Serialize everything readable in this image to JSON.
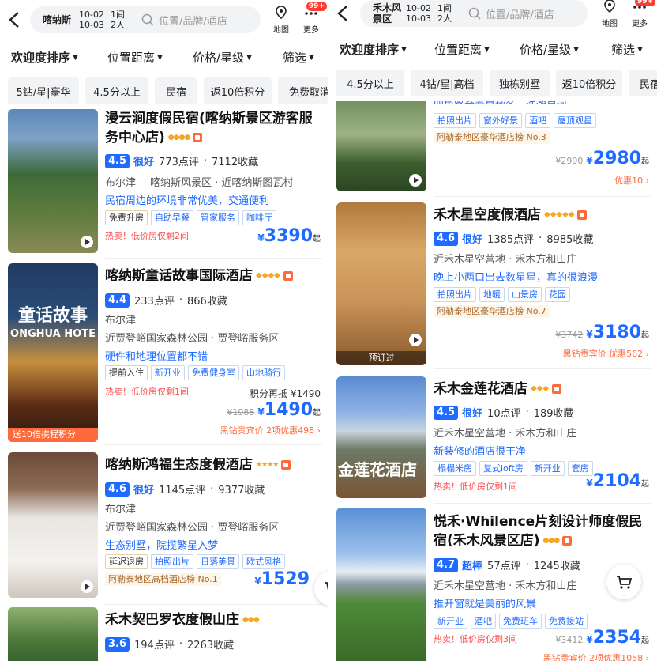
{
  "left": {
    "header": {
      "dest": "喀纳斯",
      "date_in": "10-02",
      "date_out": "10-03",
      "rooms": "1间",
      "people": "2人",
      "placeholder": "位置/品牌/酒店",
      "map": "地图",
      "more": "更多",
      "badge": "99+"
    },
    "sort": [
      "欢迎度排序",
      "位置距离",
      "价格/星级",
      "筛选"
    ],
    "chips": [
      "5钻/星|豪华",
      "4.5分以上",
      "民宿",
      "返10倍积分",
      "免费取消"
    ],
    "hotels": [
      {
        "name": "漫云涧度假民宿(喀纳斯景区游客服务中心店)",
        "score": "4.5",
        "label": "很好",
        "reviews": "773点评",
        "favs": "7112收藏",
        "area": "布尔津",
        "loc": "喀纳斯风景区 · 近喀纳斯图瓦村",
        "quote": "民宿周边的环境非常优美，交通便利",
        "tags": [
          "免费升房",
          "自助早餐",
          "管家服务",
          "咖啡厅"
        ],
        "hot": "热卖！低价房仅剩2间",
        "price": "3390",
        "price_prefix": "¥",
        "price_suffix": "起"
      },
      {
        "name": "喀纳斯童话故事国际酒店",
        "score": "4.4",
        "reviews": "233点评",
        "favs": "866收藏",
        "area": "布尔津",
        "loc": "近贾登峪国家森林公园 · 贾登峪服务区",
        "quote": "硬件和地理位置都不错",
        "tags": [
          "提前入住",
          "新开业",
          "免费健身室",
          "山地骑行"
        ],
        "hot": "热卖！低价房仅剩1间",
        "points": "积分再抵 ¥1490",
        "old": "¥1988",
        "price": "1490",
        "price_prefix": "¥",
        "price_suffix": "起",
        "promo": "黑钻贵宾价  2项优惠498 ›",
        "banner": "送10倍携程积分"
      },
      {
        "name": "喀纳斯鸿福生态度假酒店",
        "score": "4.6",
        "label": "很好",
        "reviews": "1145点评",
        "favs": "9377收藏",
        "area": "布尔津",
        "loc": "近贾登峪国家森林公园 · 贾登峪服务区",
        "quote": "生态别墅，院揽繁星入梦",
        "tags": [
          "延迟退房",
          "拍照出片",
          "日落美景",
          "欧式风格"
        ],
        "rank": "阿勒泰地区高档酒店榜 No.1",
        "price": "1529",
        "price_prefix": "¥"
      },
      {
        "name": "禾木契巴罗衣度假山庄",
        "score": "3.6",
        "reviews": "194点评",
        "favs": "2263收藏"
      }
    ]
  },
  "right": {
    "header": {
      "dest": "禾木风景区",
      "date_in": "10-02",
      "date_out": "10-03",
      "rooms": "1间",
      "people": "2人",
      "placeholder": "位置/品牌/酒店",
      "map": "地图",
      "more": "更多",
      "badge": "99+"
    },
    "sort": [
      "欢迎度排序",
      "位置距离",
      "价格/星级",
      "筛选"
    ],
    "chips": [
      "4.5分以上",
      "4钻/星|高档",
      "独栋别墅",
      "返10倍积分",
      "民宿"
    ],
    "hotels": [
      {
        "partial": "四揽路合春夏秋冬，浩瀚星河",
        "tags": [
          "拍照出片",
          "窗外好景",
          "酒吧",
          "屋顶观星"
        ],
        "rank": "阿勒泰地区豪华酒店榜 No.3",
        "old": "¥2990",
        "price": "2980",
        "price_prefix": "¥",
        "price_suffix": "起",
        "promo": "优惠10 ›"
      },
      {
        "name": "禾木星空度假酒店",
        "score": "4.6",
        "label": "很好",
        "reviews": "1385点评",
        "favs": "8985收藏",
        "loc": "近禾木星空营地 · 禾木方和山庄",
        "quote": "晚上小两口出去数星星，真的很浪漫",
        "tags": [
          "拍照出片",
          "地暖",
          "山景房",
          "花园"
        ],
        "rank": "阿勒泰地区豪华酒店榜 No.7",
        "old": "¥3742",
        "price": "3180",
        "price_prefix": "¥",
        "price_suffix": "起",
        "promo": "黑钻贵宾价  优惠562 ›",
        "badge": "预订过"
      },
      {
        "name": "禾木金莲花酒店",
        "score": "4.5",
        "label": "很好",
        "reviews": "10点评",
        "favs": "189收藏",
        "loc": "近禾木星空营地 · 禾木方和山庄",
        "quote": "新装修的酒店很干净",
        "tags": [
          "榻榻米房",
          "复式loft房",
          "新开业",
          "套房"
        ],
        "hot": "热卖！低价房仅剩1间",
        "price": "2104",
        "price_prefix": "¥",
        "price_suffix": "起"
      },
      {
        "name": "悦禾·Whilence片刻设计师度假民宿(禾木风景区店)",
        "score": "4.7",
        "label": "超棒",
        "reviews": "57点评",
        "favs": "1245收藏",
        "loc": "近禾木星空营地 · 禾木方和山庄",
        "quote": "推开窗就是美丽的风景",
        "tags": [
          "新开业",
          "酒吧",
          "免费班车",
          "免费接站"
        ],
        "hot": "热卖！低价房仅剩3间",
        "old": "¥3412",
        "price": "2354",
        "price_prefix": "¥",
        "price_suffix": "起",
        "promo": "黑钻贵宾价  2项优惠1058 ›"
      }
    ]
  },
  "colors": {
    "accent": "#1f6bff",
    "hot": "#ff4d4f",
    "star": "#f5a623"
  }
}
